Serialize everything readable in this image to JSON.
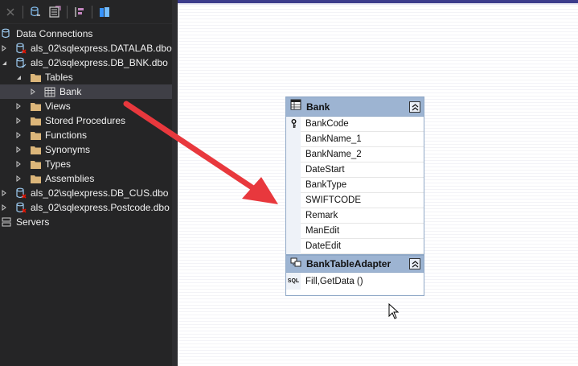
{
  "explorer": {
    "nodes": [
      {
        "label": "Data Connections",
        "icon": "data-connections-icon",
        "depth": 0,
        "expand": "none"
      },
      {
        "label": "als_02\\sqlexpress.DATALAB.dbo",
        "icon": "database-error-icon",
        "depth": 1,
        "expand": "collapsed"
      },
      {
        "label": "als_02\\sqlexpress.DB_BNK.dbo",
        "icon": "database-icon",
        "depth": 1,
        "expand": "expanded"
      },
      {
        "label": "Tables",
        "icon": "folder-icon",
        "depth": 2,
        "expand": "expanded"
      },
      {
        "label": "Bank",
        "icon": "table-icon",
        "depth": 3,
        "expand": "collapsed",
        "selected": true
      },
      {
        "label": "Views",
        "icon": "folder-icon",
        "depth": 2,
        "expand": "collapsed"
      },
      {
        "label": "Stored Procedures",
        "icon": "folder-icon",
        "depth": 2,
        "expand": "collapsed"
      },
      {
        "label": "Functions",
        "icon": "folder-icon",
        "depth": 2,
        "expand": "collapsed"
      },
      {
        "label": "Synonyms",
        "icon": "folder-icon",
        "depth": 2,
        "expand": "collapsed"
      },
      {
        "label": "Types",
        "icon": "folder-icon",
        "depth": 2,
        "expand": "collapsed"
      },
      {
        "label": "Assemblies",
        "icon": "folder-icon",
        "depth": 2,
        "expand": "collapsed"
      },
      {
        "label": "als_02\\sqlexpress.DB_CUS.dbo",
        "icon": "database-error-icon",
        "depth": 1,
        "expand": "collapsed"
      },
      {
        "label": "als_02\\sqlexpress.Postcode.dbo",
        "icon": "database-error-icon",
        "depth": 1,
        "expand": "collapsed"
      },
      {
        "label": "Servers",
        "icon": "servers-icon",
        "depth": 0,
        "expand": "none"
      }
    ]
  },
  "datatable": {
    "title": "Bank",
    "columns": [
      "BankCode",
      "BankName_1",
      "BankName_2",
      "DateStart",
      "BankType",
      "SWIFTCODE",
      "Remark",
      "ManEdit",
      "DateEdit"
    ],
    "key_column": "BankCode",
    "adapter_title": "BankTableAdapter",
    "query": "Fill,GetData ()",
    "query_icon_text": "SQL"
  },
  "colors": {
    "explorer_bg": "#252526",
    "header_blue": "#9db4d2",
    "arrow_red": "#e8383d",
    "folder": "#dcb67a",
    "error_red": "#e51400"
  }
}
